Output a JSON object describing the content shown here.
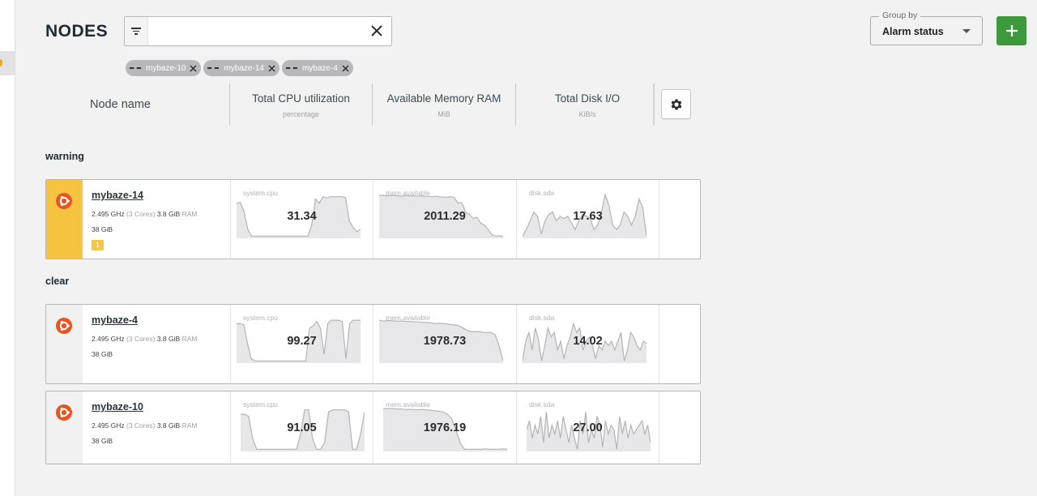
{
  "page": {
    "title": "NODES"
  },
  "filter": {
    "value": "",
    "placeholder": "",
    "icon": "filter-icon",
    "chips": [
      {
        "label": "mybaze-10"
      },
      {
        "label": "mybaze-14"
      },
      {
        "label": "mybaze-4"
      }
    ]
  },
  "group_by": {
    "label": "Group by",
    "value": "Alarm status"
  },
  "columns": {
    "node_name": "Node name",
    "cpu": {
      "title": "Total CPU utilization",
      "unit": "percentage"
    },
    "memory": {
      "title": "Available Memory RAM",
      "unit": "MiB"
    },
    "disk": {
      "title": "Total Disk I/O",
      "unit": "KiB/s"
    }
  },
  "groups": [
    {
      "label": "warning",
      "nodes": [
        {
          "name": "mybaze-14",
          "cpu_freq": "2.495 GHz",
          "cores": "(3 Cores)",
          "ram": "3.8 GiB",
          "ram_unit": "RAM",
          "disk": "38 GiB",
          "alarm_count": "1",
          "status": "warning",
          "cpu": {
            "label": "system.cpu",
            "value": "31.34",
            "series": [
              80,
              82,
              60,
              20,
              5,
              5,
              5,
              5,
              5,
              5,
              5,
              5,
              5,
              5,
              5,
              5,
              5,
              5,
              5,
              5,
              30,
              90,
              80,
              95,
              92,
              95,
              95,
              95,
              95,
              93,
              40,
              25,
              15,
              20
            ]
          },
          "mem": {
            "label": "mem.available",
            "value": "2011.29",
            "series": [
              98,
              98,
              97,
              98,
              98,
              97,
              96,
              98,
              97,
              97,
              96,
              97,
              96,
              96,
              95,
              96,
              95,
              94,
              94,
              95,
              93,
              80,
              82,
              60,
              55,
              45,
              48,
              35,
              30,
              20,
              8,
              5,
              6,
              4
            ]
          },
          "disk_io": {
            "label": "disk.sda",
            "value": "17.63",
            "series": [
              5,
              20,
              40,
              60,
              50,
              10,
              40,
              55,
              60,
              40,
              50,
              45,
              50,
              35,
              20,
              40,
              55,
              50,
              45,
              20,
              30,
              60,
              100,
              75,
              30,
              20,
              30,
              60,
              50,
              30,
              50,
              90,
              70,
              5
            ]
          }
        }
      ]
    },
    {
      "label": "clear",
      "nodes": [
        {
          "name": "mybaze-4",
          "cpu_freq": "2.495 GHz",
          "cores": "(3 Cores)",
          "ram": "3.8 GiB",
          "ram_unit": "RAM",
          "disk": "38 GiB",
          "status": "clear",
          "cpu": {
            "label": "system.cpu",
            "value": "99.27",
            "series": [
              90,
              90,
              88,
              45,
              10,
              5,
              5,
              5,
              5,
              5,
              5,
              5,
              5,
              5,
              5,
              5,
              5,
              5,
              5,
              5,
              80,
              85,
              95,
              80,
              20,
              90,
              98,
              98,
              98,
              95,
              10,
              90,
              98,
              98,
              98
            ]
          },
          "mem": {
            "label": "mem.available",
            "value": "1978.73",
            "series": [
              98,
              96,
              97,
              97,
              96,
              96,
              96,
              95,
              95,
              94,
              94,
              93,
              93,
              92,
              90,
              91,
              90,
              89,
              88,
              87,
              85,
              80,
              75,
              72,
              72,
              72,
              70,
              70,
              70,
              65,
              40,
              5
            ]
          },
          "disk_io": {
            "label": "disk.sda",
            "value": "14.02",
            "series": [
              5,
              50,
              70,
              30,
              80,
              55,
              5,
              40,
              80,
              60,
              70,
              30,
              50,
              10,
              40,
              60,
              90,
              70,
              80,
              30,
              50,
              60,
              40,
              10,
              40,
              30,
              50,
              40,
              50,
              30,
              50,
              70,
              5,
              30,
              70,
              60,
              40,
              30,
              50,
              45
            ]
          }
        },
        {
          "name": "mybaze-10",
          "cpu_freq": "2.495 GHz",
          "cores": "(3 Cores)",
          "ram": "3.8 GiB",
          "ram_unit": "RAM",
          "disk": "38 GiB",
          "status": "clear",
          "cpu": {
            "label": "system.cpu",
            "value": "91.05",
            "series": [
              85,
              85,
              80,
              30,
              5,
              5,
              5,
              5,
              5,
              5,
              5,
              5,
              5,
              5,
              5,
              40,
              95,
              95,
              30,
              5,
              5,
              20,
              90,
              95,
              95,
              95,
              95,
              90,
              5,
              5,
              40,
              90
            ]
          },
          "mem": {
            "label": "mem.available",
            "value": "1976.19",
            "series": [
              98,
              98,
              98,
              97,
              97,
              96,
              96,
              96,
              95,
              96,
              95,
              94,
              93,
              92,
              90,
              85,
              75,
              50,
              20,
              5,
              5,
              5,
              5,
              5,
              6,
              5,
              5,
              5,
              6,
              5
            ]
          },
          "disk_io": {
            "label": "disk.sda",
            "value": "27.00",
            "series": [
              50,
              70,
              30,
              60,
              40,
              80,
              20,
              90,
              30,
              60,
              40,
              70,
              30,
              80,
              50,
              20,
              60,
              30,
              5,
              70,
              40,
              90,
              20,
              50,
              30,
              80,
              60,
              10,
              70,
              40,
              60,
              50,
              5,
              80,
              40,
              70,
              30,
              60,
              40,
              50,
              60,
              70,
              40,
              60,
              20
            ]
          }
        }
      ]
    }
  ],
  "colors": {
    "warning": "#f7c442",
    "accent_add": "#3c9a3c",
    "ubuntu": "#e95420",
    "chart_fill": "#e7e7e9",
    "chart_line": "#b4b4b7"
  }
}
